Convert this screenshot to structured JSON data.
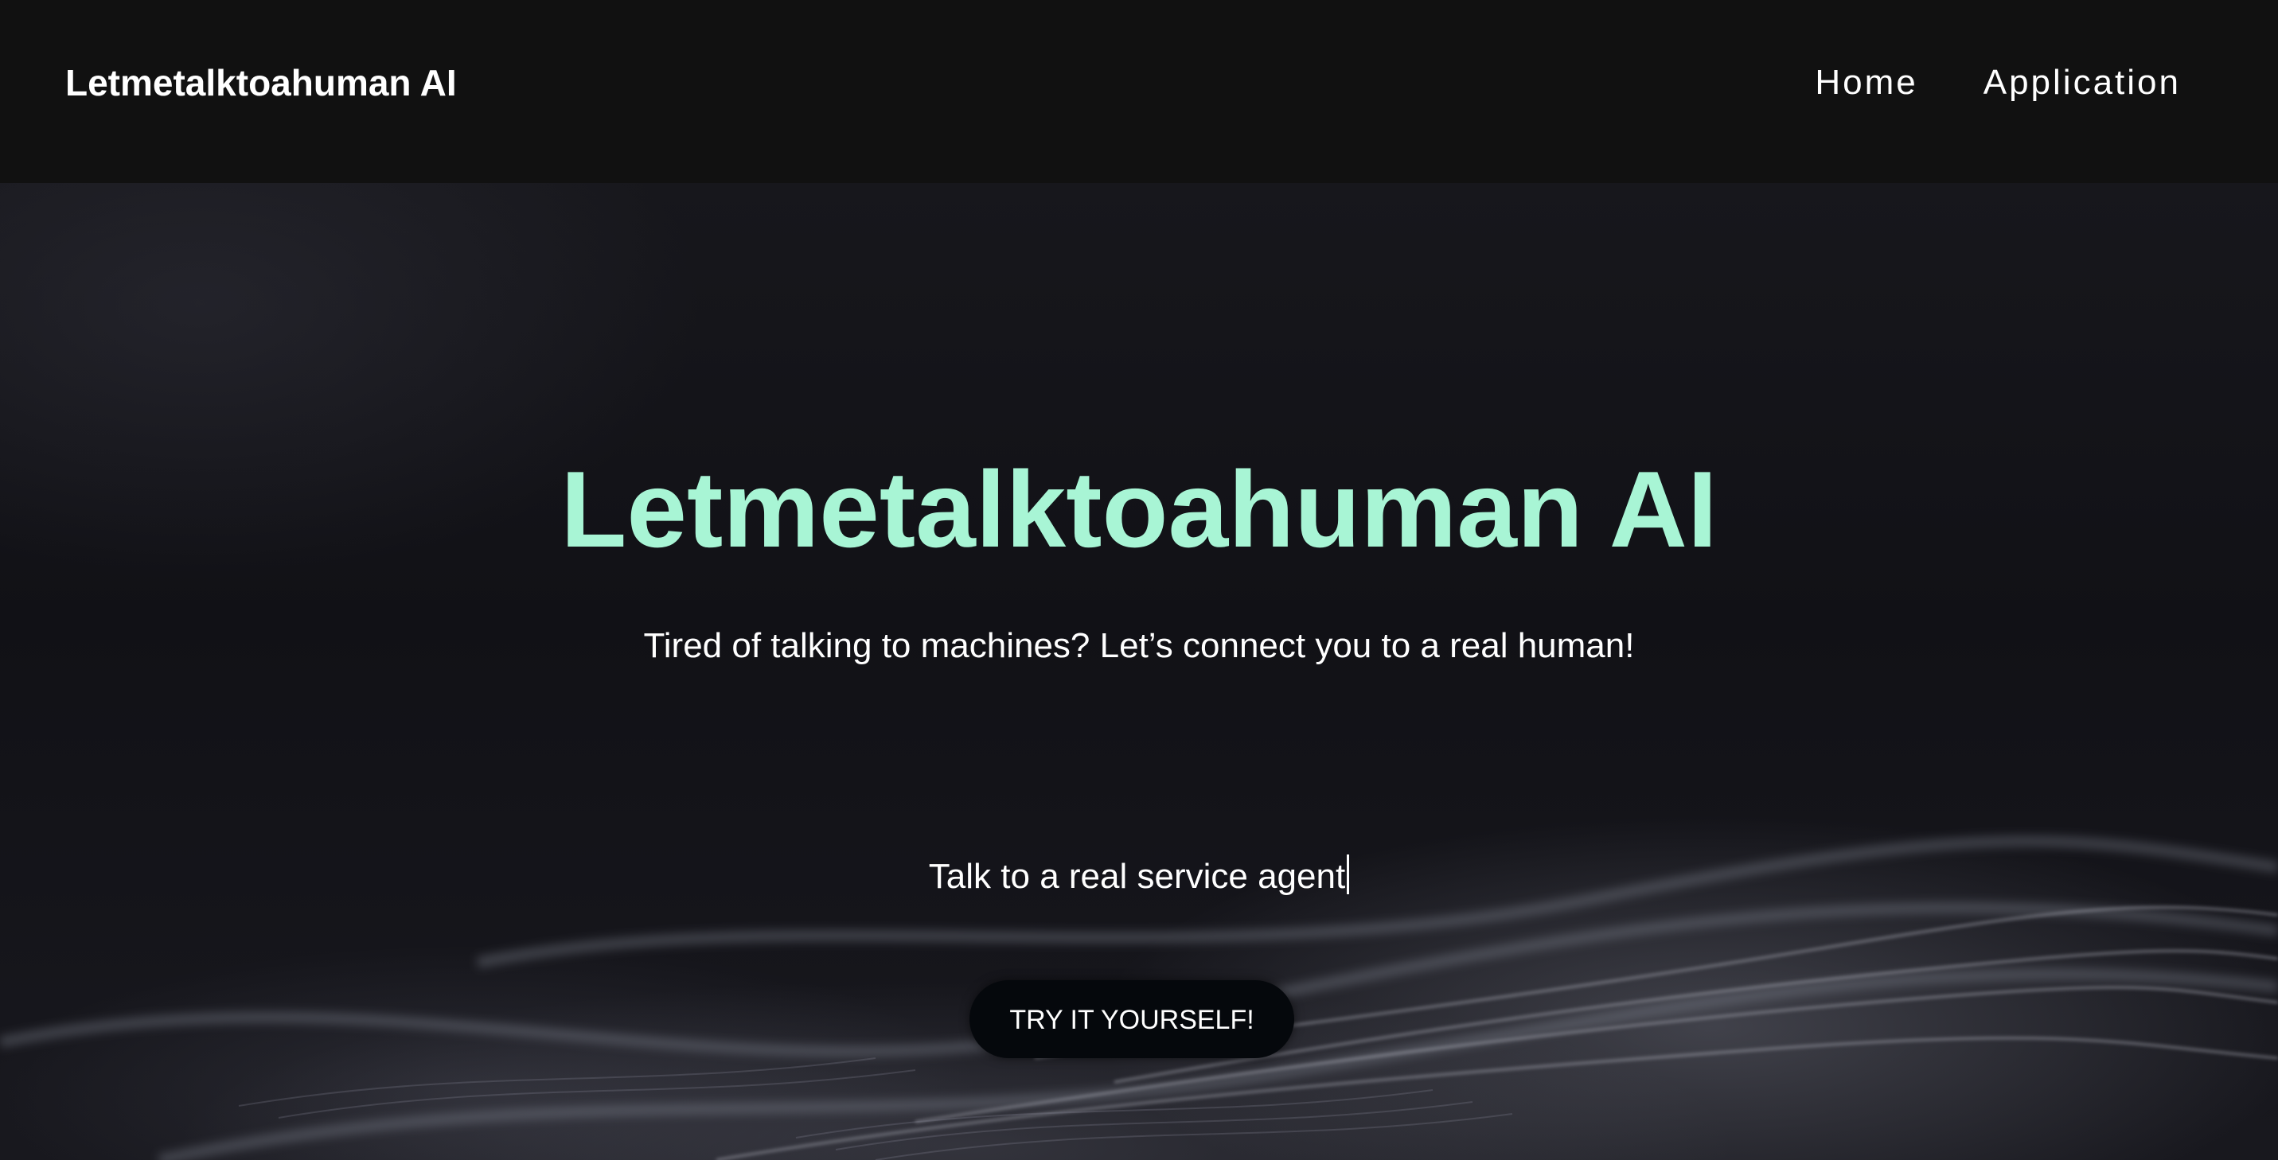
{
  "navbar": {
    "brand": "Letmetalktoahuman AI",
    "links": [
      {
        "label": "Home"
      },
      {
        "label": "Application"
      }
    ]
  },
  "hero": {
    "title": "Letmetalktoahuman AI",
    "subtitle": "Tired of talking to machines? Let’s connect you to a real human!",
    "typed_text": "Talk to a real service agent",
    "cta_label": "TRY IT YOURSELF!"
  },
  "colors": {
    "navbar_bg": "#111111",
    "accent_title": "#a8f5d5",
    "button_bg": "#05080c",
    "text": "#ffffff"
  }
}
